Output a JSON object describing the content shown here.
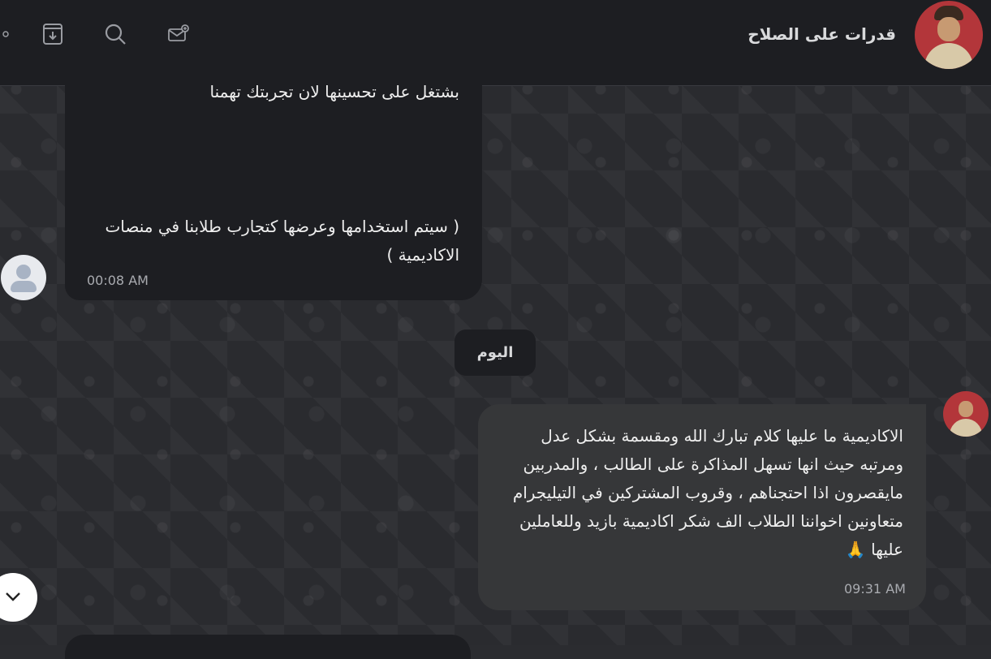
{
  "header": {
    "title": "قدرات على الصلاح",
    "icons": [
      "mail-add-icon",
      "search-icon",
      "archive-download-icon",
      "more-menu-icon"
    ]
  },
  "messages": [
    {
      "direction": "incoming",
      "line1": "بشتغل على تحسينها لان تجربتك تهمنا",
      "text": "( سيتم استخدامها وعرضها كتجارب طلابنا في منصات الاكاديمية )",
      "time": "00:08 AM"
    },
    {
      "direction": "outgoing",
      "text": "الاكاديمية ما عليها كلام تبارك الله ومقسمة بشكل عدل ومرتبه حيث انها تسهل المذاكرة على الطالب ، والمدربين مايقصرون اذا احتجناهم ، وقروب المشتركين في التيليجرام متعاونين اخواننا الطلاب الف شكر اكاديمية بازيد وللعاملين عليها 🙏",
      "time": "09:31 AM"
    }
  ],
  "date_separator": "اليوم",
  "colors": {
    "header_bg": "#1d1e22",
    "incoming_bubble": "#1d1e22",
    "outgoing_bubble": "#363739",
    "text": "#eeeeee",
    "time": "#a9abb0"
  }
}
